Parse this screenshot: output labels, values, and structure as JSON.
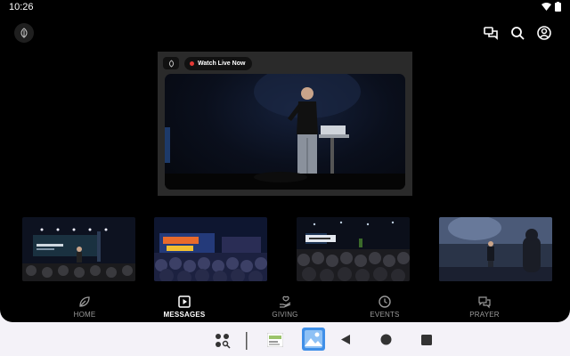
{
  "status_bar": {
    "time": "10:26"
  },
  "featured": {
    "live_label": "Watch Live Now"
  },
  "nav": {
    "items": [
      {
        "label": "HOME",
        "icon": "leaf-icon",
        "active": false
      },
      {
        "label": "MESSAGES",
        "icon": "play-box-icon",
        "active": true
      },
      {
        "label": "GIVING",
        "icon": "giving-hand-icon",
        "active": false
      },
      {
        "label": "EVENTS",
        "icon": "clock-icon",
        "active": false
      },
      {
        "label": "PRAYER",
        "icon": "chat-bubbles-icon",
        "active": false
      }
    ]
  },
  "thumbnails": {
    "items": [
      {
        "icon": "sermon-stage-thumbnail"
      },
      {
        "icon": "worship-crowd-thumbnail"
      },
      {
        "icon": "stage-screen-thumbnail"
      },
      {
        "icon": "speaker-stage-thumbnail"
      }
    ]
  },
  "colors": {
    "accent_live": "#e53935",
    "background": "#000000",
    "nav_active": "#ffffff",
    "nav_inactive": "#9a9a9a"
  }
}
